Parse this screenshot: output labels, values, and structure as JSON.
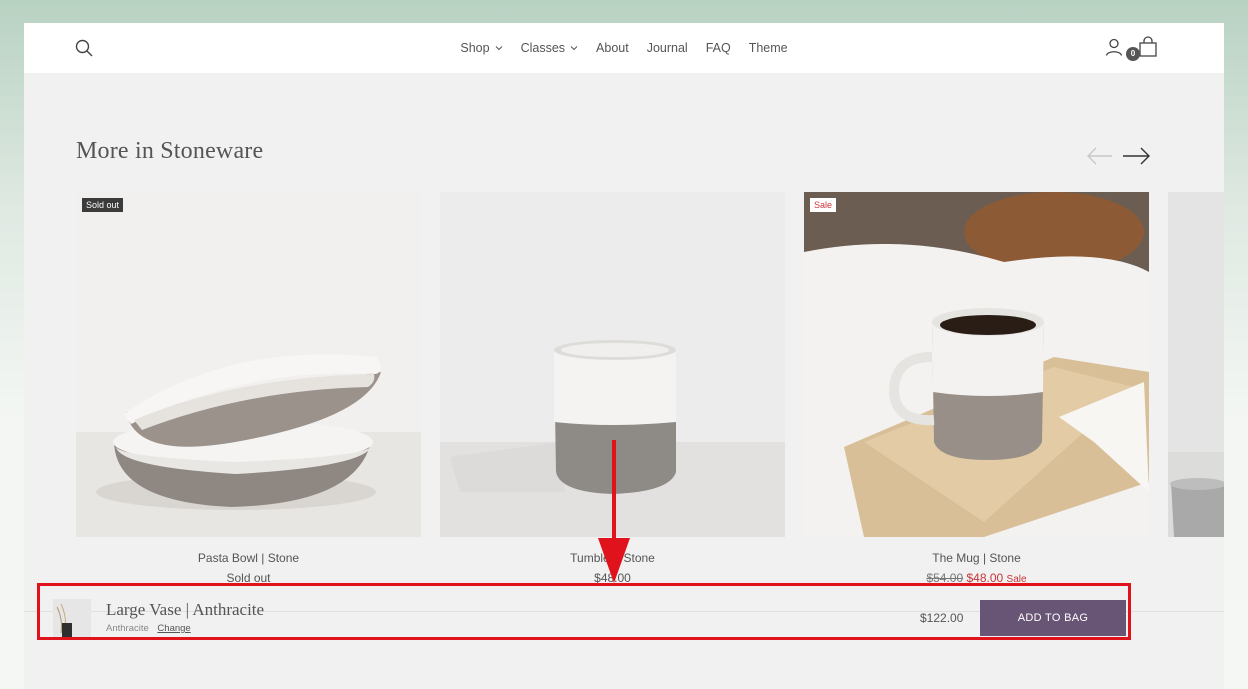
{
  "header": {
    "nav": [
      {
        "label": "Shop",
        "has_dropdown": true
      },
      {
        "label": "Classes",
        "has_dropdown": true
      },
      {
        "label": "About"
      },
      {
        "label": "Journal"
      },
      {
        "label": "FAQ"
      },
      {
        "label": "Theme"
      }
    ],
    "cart_count": "0"
  },
  "section": {
    "title": "More in Stoneware"
  },
  "products": [
    {
      "title": "Pasta Bowl | Stone",
      "price": "Sold out",
      "badge": "Sold out"
    },
    {
      "title": "Tumbler | Stone",
      "price": "$48.00"
    },
    {
      "title": "The Mug | Stone",
      "old_price": "$54.00",
      "sale_price": "$48.00",
      "sale_label": "Sale",
      "badge": "Sale"
    }
  ],
  "sticky_bar": {
    "product_name": "Large Vase | Anthracite",
    "variant": "Anthracite",
    "change_label": "Change",
    "price": "$122.00",
    "button_label": "ADD TO BAG"
  },
  "colors": {
    "accent_button": "#685474",
    "sale": "#c9343a",
    "highlight": "#e0121b"
  }
}
